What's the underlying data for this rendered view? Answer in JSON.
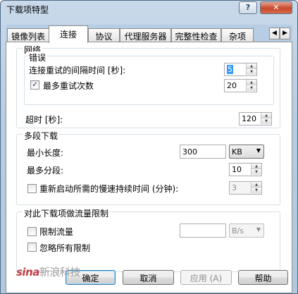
{
  "window": {
    "title": "下载项特型"
  },
  "titlebar": {
    "help_label": "?",
    "close_label": "✕"
  },
  "tabs": [
    {
      "label": "镜像列表",
      "active": false
    },
    {
      "label": "连接",
      "active": true
    },
    {
      "label": "协议",
      "active": false
    },
    {
      "label": "代理服务器",
      "active": false
    },
    {
      "label": "完整性检查",
      "active": false
    },
    {
      "label": "杂项",
      "active": false
    }
  ],
  "tab_scroll": {
    "left": "◀",
    "right": "▶"
  },
  "network": {
    "title": "网络",
    "error": {
      "title": "错误",
      "retry_interval_label": "连接重试的间隔时间 [秒]:",
      "retry_interval_value": "5",
      "max_retries_label": "最多重试次数",
      "max_retries_checked": true,
      "max_retries_value": "20"
    },
    "timeout_label": "超时 [秒]:",
    "timeout_value": "120"
  },
  "multipart": {
    "title": "多段下载",
    "min_size_label": "最小长度:",
    "min_size_value": "300",
    "min_size_unit": "KB",
    "max_parts_label": "最多分段:",
    "max_parts_value": "10",
    "restart_slow_label": "重新启动所需的慢速持续时间 (分钟):",
    "restart_slow_checked": false,
    "restart_slow_value": "3"
  },
  "traffic": {
    "title": "对此下载项做流量限制",
    "limit_label": "限制流量",
    "limit_checked": false,
    "limit_value": "",
    "limit_unit": "B/s",
    "ignore_all_label": "忽略所有限制",
    "ignore_all_checked": false
  },
  "buttons": {
    "ok": "确定",
    "cancel": "取消",
    "apply": "应用 (A)",
    "help": "帮助"
  },
  "watermark": {
    "brand": "sina",
    "text": "新浪科技"
  },
  "icons": {
    "check": "✓",
    "spin_up": "▲",
    "spin_down": "▼",
    "combo_arrow": "▼"
  }
}
